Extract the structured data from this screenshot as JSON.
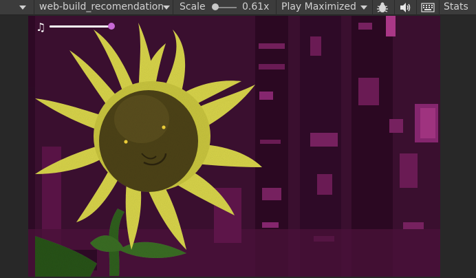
{
  "toolbar": {
    "scene_dropdown": "web-build_recomendation",
    "scale_label": "Scale",
    "scale_value": "0.61x",
    "play_mode": "Play Maximized",
    "stats_label": "Stats"
  },
  "game": {
    "music_note": "♫",
    "volume_level": 0.95,
    "colors": {
      "background": "#3a0f2f",
      "accent": "#c869d6",
      "petal": "#d8d44a",
      "face": "#4d4317",
      "stem": "#2f5f1d"
    }
  },
  "icons": [
    "dropdown-arrow-icon",
    "bug-icon",
    "audio-icon",
    "grid-icon",
    "music-note-icon"
  ]
}
